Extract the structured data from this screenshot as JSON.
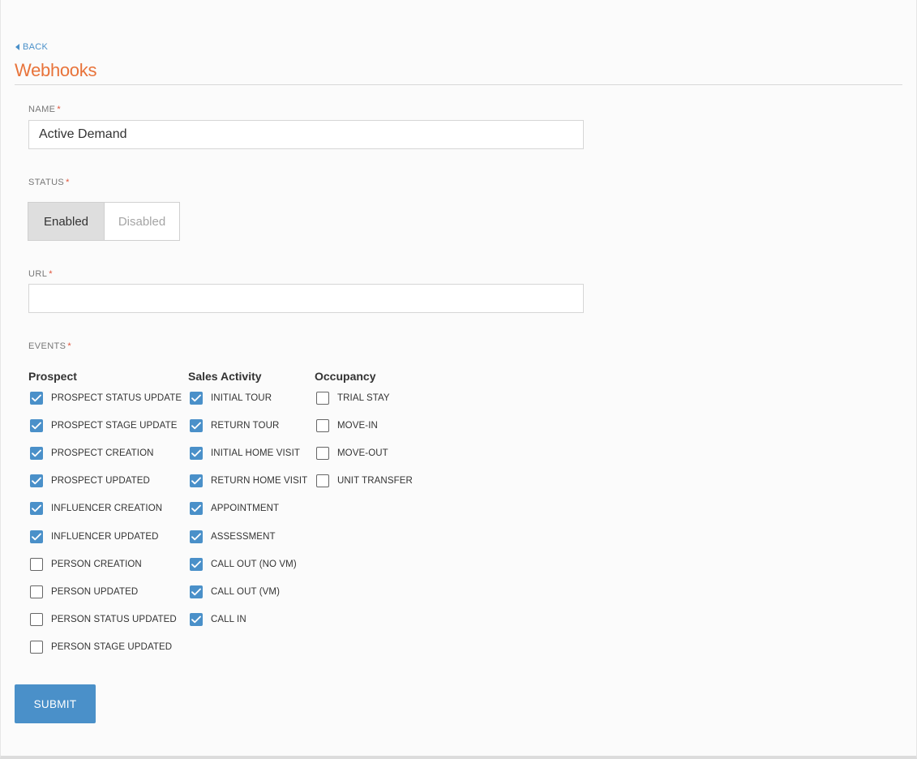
{
  "nav": {
    "back_label": "BACK"
  },
  "page": {
    "title": "Webhooks"
  },
  "form": {
    "name": {
      "label": "NAME",
      "required_mark": "*",
      "value": "Active Demand",
      "placeholder": ""
    },
    "status": {
      "label": "STATUS",
      "required_mark": "*",
      "options": [
        "Enabled",
        "Disabled"
      ],
      "selected": "Enabled"
    },
    "url": {
      "label": "URL",
      "required_mark": "*",
      "value": "",
      "placeholder": ""
    },
    "events": {
      "label": "EVENTS",
      "required_mark": "*",
      "columns": [
        {
          "heading": "Prospect",
          "items": [
            {
              "label": "PROSPECT STATUS UPDATE",
              "checked": true
            },
            {
              "label": "PROSPECT STAGE UPDATE",
              "checked": true
            },
            {
              "label": "PROSPECT CREATION",
              "checked": true
            },
            {
              "label": "PROSPECT UPDATED",
              "checked": true
            },
            {
              "label": "INFLUENCER CREATION",
              "checked": true
            },
            {
              "label": "INFLUENCER UPDATED",
              "checked": true
            },
            {
              "label": "PERSON CREATION",
              "checked": false
            },
            {
              "label": "PERSON UPDATED",
              "checked": false
            },
            {
              "label": "PERSON STATUS UPDATED",
              "checked": false
            },
            {
              "label": "PERSON STAGE UPDATED",
              "checked": false
            }
          ]
        },
        {
          "heading": "Sales Activity",
          "items": [
            {
              "label": "INITIAL TOUR",
              "checked": true
            },
            {
              "label": "RETURN TOUR",
              "checked": true
            },
            {
              "label": "INITIAL HOME VISIT",
              "checked": true
            },
            {
              "label": "RETURN HOME VISIT",
              "checked": true
            },
            {
              "label": "APPOINTMENT",
              "checked": true
            },
            {
              "label": "ASSESSMENT",
              "checked": true
            },
            {
              "label": "CALL OUT (NO VM)",
              "checked": true
            },
            {
              "label": "CALL OUT (VM)",
              "checked": true
            },
            {
              "label": "CALL IN",
              "checked": true
            }
          ]
        },
        {
          "heading": "Occupancy",
          "items": [
            {
              "label": "TRIAL STAY",
              "checked": false
            },
            {
              "label": "MOVE-IN",
              "checked": false
            },
            {
              "label": "MOVE-OUT",
              "checked": false
            },
            {
              "label": "UNIT TRANSFER",
              "checked": false
            }
          ]
        }
      ]
    },
    "submit_label": "SUBMIT"
  },
  "colors": {
    "accent": "#4a90c9",
    "title": "#e8733a",
    "required": "#e0533a"
  }
}
